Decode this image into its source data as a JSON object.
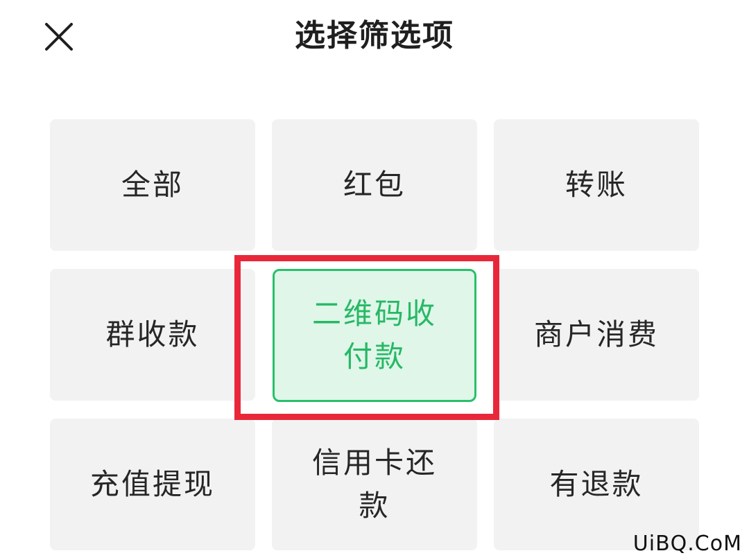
{
  "header": {
    "title": "选择筛选项",
    "close_icon": "close-icon"
  },
  "filters": [
    {
      "label": "全部"
    },
    {
      "label": "红包"
    },
    {
      "label": "转账"
    },
    {
      "label": "群收款"
    },
    {
      "label": "二维码收付款",
      "selected": true
    },
    {
      "label": "商户消费"
    },
    {
      "label": "充值提现"
    },
    {
      "label": "信用卡还款"
    },
    {
      "label": "有退款"
    }
  ],
  "colors": {
    "accent": "#27c06a",
    "selected_bg": "#dff6e9",
    "highlight_border": "#e8283a",
    "tile_bg": "#f2f2f2"
  },
  "watermark": "UiBQ.CoM"
}
